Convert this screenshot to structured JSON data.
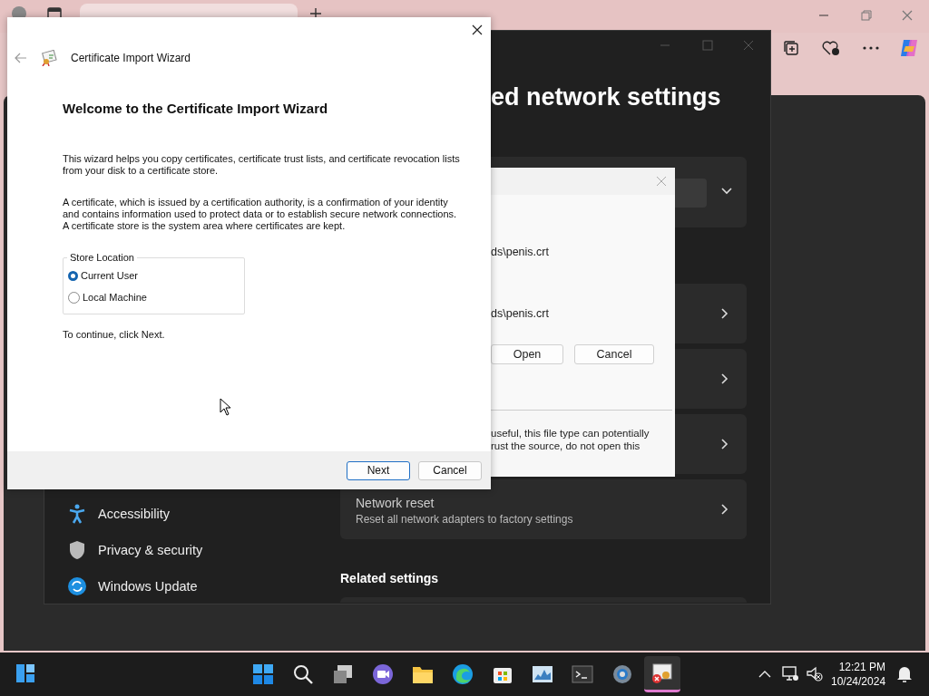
{
  "settings_window": {
    "heading": "ed network settings",
    "network_reset": {
      "title": "Network reset",
      "subtitle": "Reset all network adapters to factory settings"
    },
    "related": "Related settings"
  },
  "sidebar": {
    "items": [
      {
        "label": "Accessibility",
        "kind": "accessibility"
      },
      {
        "label": "Privacy & security",
        "kind": "privacy"
      },
      {
        "label": "Windows Update",
        "kind": "update"
      }
    ]
  },
  "file_dialog": {
    "lines": [
      "ds\\penis.crt",
      "ds\\penis.crt"
    ],
    "buttons": [
      "Open",
      "Cancel"
    ],
    "warning": [
      "useful, this file type can potentially",
      "rust the source, do not open this"
    ]
  },
  "wizard": {
    "title": "Certificate Import Wizard",
    "heading": "Welcome to the Certificate Import Wizard",
    "paragraphs": [
      "This wizard helps you copy certificates, certificate trust lists, and certificate revocation lists from your disk to a certificate store.",
      "A certificate, which is issued by a certification authority, is a confirmation of your identity and contains information used to protect data or to establish secure network connections. A certificate store is the system area where certificates are kept."
    ],
    "store_location": {
      "label": "Store Location",
      "options": [
        {
          "label": "Current User",
          "selected": true
        },
        {
          "label": "Local Machine",
          "selected": false
        }
      ]
    },
    "hint": "To continue, click Next.",
    "buttons": [
      {
        "label": "Next",
        "default": true
      },
      {
        "label": "Cancel",
        "default": false
      }
    ]
  },
  "taskbar": {
    "time": "12:21 PM",
    "date": "10/24/2024"
  }
}
